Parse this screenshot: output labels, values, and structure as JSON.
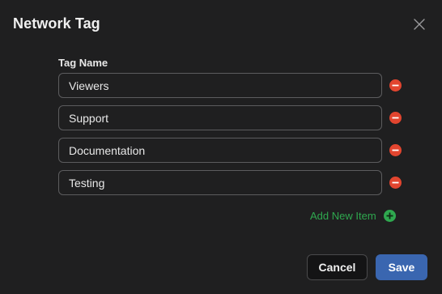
{
  "dialog": {
    "title": "Network Tag",
    "close_icon": "close-icon"
  },
  "form": {
    "field_label": "Tag Name",
    "items": [
      {
        "value": "Viewers",
        "remove_icon": "minus-circle-icon"
      },
      {
        "value": "Support",
        "remove_icon": "minus-circle-icon"
      },
      {
        "value": "Documentation",
        "remove_icon": "minus-circle-icon"
      },
      {
        "value": "Testing",
        "remove_icon": "minus-circle-icon"
      }
    ],
    "add_label": "Add New Item",
    "add_icon": "plus-circle-icon"
  },
  "footer": {
    "cancel_label": "Cancel",
    "save_label": "Save"
  },
  "colors": {
    "background": "#1f1f20",
    "remove": "#e2452f",
    "add": "#2fa84f",
    "primary": "#3a66b0"
  }
}
